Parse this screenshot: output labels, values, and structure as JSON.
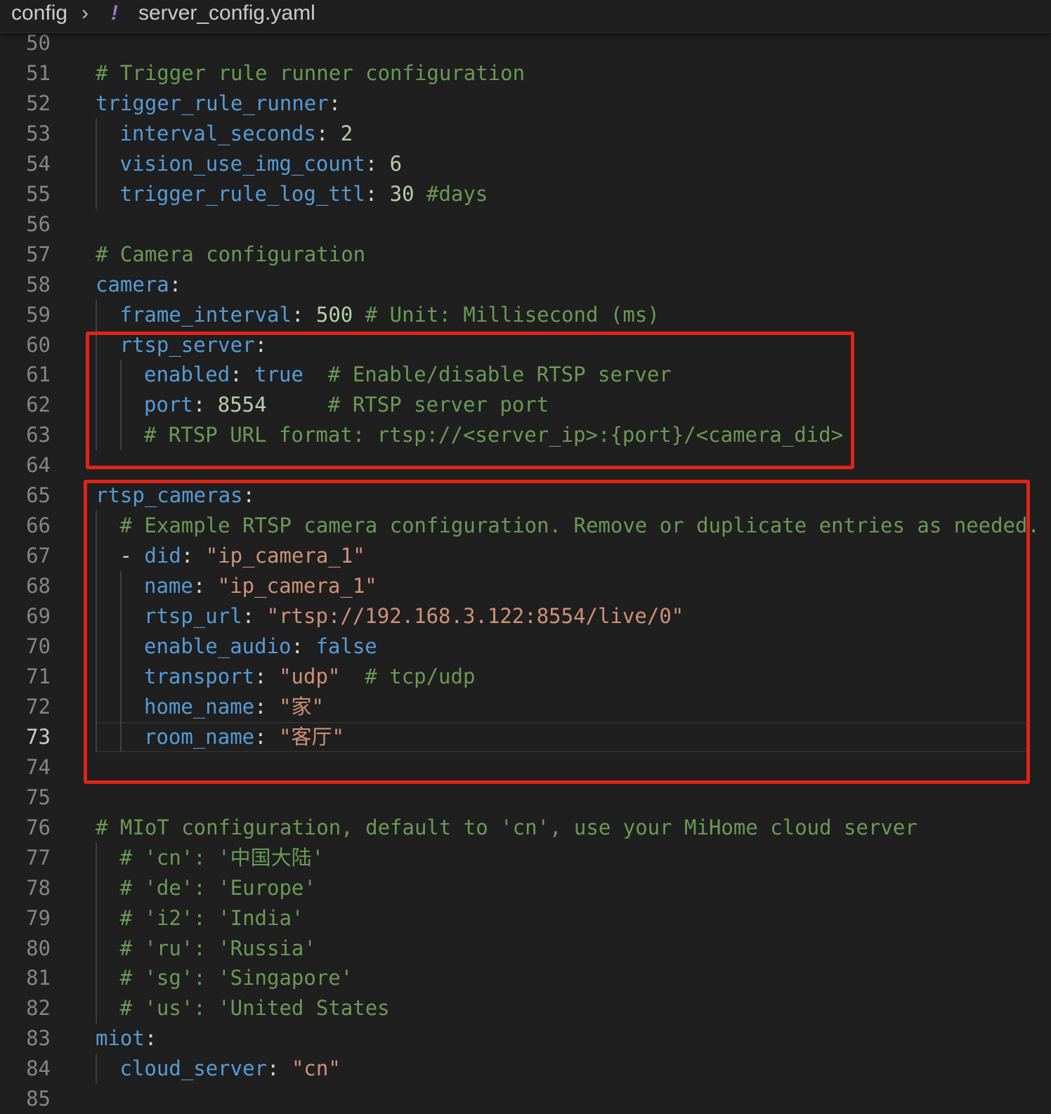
{
  "breadcrumb": {
    "folder": "config",
    "separator": "›",
    "file_icon": "!",
    "file_icon_name": "yaml-file-icon",
    "file": "server_config.yaml"
  },
  "editor": {
    "current_line": 73,
    "colors": {
      "key": "#569cd6",
      "comment": "#6a9955",
      "string": "#ce9178",
      "number": "#b5cea8",
      "highlight_box": "#e02418"
    },
    "lines": [
      {
        "n": "50",
        "indent": 0,
        "tokens": []
      },
      {
        "n": "51",
        "indent": 0,
        "tokens": [
          {
            "t": "c",
            "v": "# Trigger rule runner configuration"
          }
        ]
      },
      {
        "n": "52",
        "indent": 0,
        "tokens": [
          {
            "t": "k",
            "v": "trigger_rule_runner"
          },
          {
            "t": "p",
            "v": ":"
          }
        ]
      },
      {
        "n": "53",
        "indent": 1,
        "tokens": [
          {
            "t": "k",
            "v": "interval_seconds"
          },
          {
            "t": "p",
            "v": ": "
          },
          {
            "t": "n",
            "v": "2"
          }
        ]
      },
      {
        "n": "54",
        "indent": 1,
        "tokens": [
          {
            "t": "k",
            "v": "vision_use_img_count"
          },
          {
            "t": "p",
            "v": ": "
          },
          {
            "t": "n",
            "v": "6"
          }
        ]
      },
      {
        "n": "55",
        "indent": 1,
        "tokens": [
          {
            "t": "k",
            "v": "trigger_rule_log_ttl"
          },
          {
            "t": "p",
            "v": ": "
          },
          {
            "t": "n",
            "v": "30"
          },
          {
            "t": "p",
            "v": " "
          },
          {
            "t": "c",
            "v": "#days"
          }
        ]
      },
      {
        "n": "56",
        "indent": 0,
        "tokens": []
      },
      {
        "n": "57",
        "indent": 0,
        "tokens": [
          {
            "t": "c",
            "v": "# Camera configuration"
          }
        ]
      },
      {
        "n": "58",
        "indent": 0,
        "tokens": [
          {
            "t": "k",
            "v": "camera"
          },
          {
            "t": "p",
            "v": ":"
          }
        ]
      },
      {
        "n": "59",
        "indent": 1,
        "tokens": [
          {
            "t": "k",
            "v": "frame_interval"
          },
          {
            "t": "p",
            "v": ": "
          },
          {
            "t": "n",
            "v": "500"
          },
          {
            "t": "p",
            "v": " "
          },
          {
            "t": "c",
            "v": "# Unit: Millisecond (ms)"
          }
        ]
      },
      {
        "n": "60",
        "indent": 1,
        "tokens": [
          {
            "t": "k",
            "v": "rtsp_server"
          },
          {
            "t": "p",
            "v": ":"
          }
        ]
      },
      {
        "n": "61",
        "indent": 2,
        "tokens": [
          {
            "t": "k",
            "v": "enabled"
          },
          {
            "t": "p",
            "v": ": "
          },
          {
            "t": "b",
            "v": "true"
          },
          {
            "t": "p",
            "v": "  "
          },
          {
            "t": "c",
            "v": "# Enable/disable RTSP server"
          }
        ]
      },
      {
        "n": "62",
        "indent": 2,
        "tokens": [
          {
            "t": "k",
            "v": "port"
          },
          {
            "t": "p",
            "v": ": "
          },
          {
            "t": "n",
            "v": "8554"
          },
          {
            "t": "p",
            "v": "     "
          },
          {
            "t": "c",
            "v": "# RTSP server port"
          }
        ]
      },
      {
        "n": "63",
        "indent": 2,
        "tokens": [
          {
            "t": "c",
            "v": "# RTSP URL format: rtsp://<server_ip>:{port}/<camera_did>"
          }
        ]
      },
      {
        "n": "64",
        "indent": 0,
        "tokens": []
      },
      {
        "n": "65",
        "indent": 0,
        "tokens": [
          {
            "t": "k",
            "v": "rtsp_cameras"
          },
          {
            "t": "p",
            "v": ":"
          }
        ]
      },
      {
        "n": "66",
        "indent": 1,
        "tokens": [
          {
            "t": "c",
            "v": "# Example RTSP camera configuration. Remove or duplicate entries as needed."
          }
        ]
      },
      {
        "n": "67",
        "indent": 1,
        "tokens": [
          {
            "t": "p",
            "v": "- "
          },
          {
            "t": "k",
            "v": "did"
          },
          {
            "t": "p",
            "v": ": "
          },
          {
            "t": "s",
            "v": "\"ip_camera_1\""
          }
        ]
      },
      {
        "n": "68",
        "indent": 2,
        "tokens": [
          {
            "t": "k",
            "v": "name"
          },
          {
            "t": "p",
            "v": ": "
          },
          {
            "t": "s",
            "v": "\"ip_camera_1\""
          }
        ]
      },
      {
        "n": "69",
        "indent": 2,
        "tokens": [
          {
            "t": "k",
            "v": "rtsp_url"
          },
          {
            "t": "p",
            "v": ": "
          },
          {
            "t": "s",
            "v": "\"rtsp://192.168.3.122:8554/live/0\""
          }
        ]
      },
      {
        "n": "70",
        "indent": 2,
        "tokens": [
          {
            "t": "k",
            "v": "enable_audio"
          },
          {
            "t": "p",
            "v": ": "
          },
          {
            "t": "b",
            "v": "false"
          }
        ]
      },
      {
        "n": "71",
        "indent": 2,
        "tokens": [
          {
            "t": "k",
            "v": "transport"
          },
          {
            "t": "p",
            "v": ": "
          },
          {
            "t": "s",
            "v": "\"udp\""
          },
          {
            "t": "p",
            "v": "  "
          },
          {
            "t": "c",
            "v": "# tcp/udp"
          }
        ]
      },
      {
        "n": "72",
        "indent": 2,
        "tokens": [
          {
            "t": "k",
            "v": "home_name"
          },
          {
            "t": "p",
            "v": ": "
          },
          {
            "t": "s",
            "v": "\"家\""
          }
        ]
      },
      {
        "n": "73",
        "indent": 2,
        "tokens": [
          {
            "t": "k",
            "v": "room_name"
          },
          {
            "t": "p",
            "v": ": "
          },
          {
            "t": "s",
            "v": "\"客厅\""
          }
        ]
      },
      {
        "n": "74",
        "indent": 0,
        "tokens": []
      },
      {
        "n": "75",
        "indent": 0,
        "tokens": []
      },
      {
        "n": "76",
        "indent": 0,
        "tokens": [
          {
            "t": "c",
            "v": "# MIoT configuration, default to 'cn', use your MiHome cloud server"
          }
        ]
      },
      {
        "n": "77",
        "indent": 1,
        "tokens": [
          {
            "t": "c",
            "v": "# 'cn': '中国大陆'"
          }
        ]
      },
      {
        "n": "78",
        "indent": 1,
        "tokens": [
          {
            "t": "c",
            "v": "# 'de': 'Europe'"
          }
        ]
      },
      {
        "n": "79",
        "indent": 1,
        "tokens": [
          {
            "t": "c",
            "v": "# 'i2': 'India'"
          }
        ]
      },
      {
        "n": "80",
        "indent": 1,
        "tokens": [
          {
            "t": "c",
            "v": "# 'ru': 'Russia'"
          }
        ]
      },
      {
        "n": "81",
        "indent": 1,
        "tokens": [
          {
            "t": "c",
            "v": "# 'sg': 'Singapore'"
          }
        ]
      },
      {
        "n": "82",
        "indent": 1,
        "tokens": [
          {
            "t": "c",
            "v": "# 'us': 'United States"
          }
        ]
      },
      {
        "n": "83",
        "indent": 0,
        "tokens": [
          {
            "t": "k",
            "v": "miot"
          },
          {
            "t": "p",
            "v": ":"
          }
        ]
      },
      {
        "n": "84",
        "indent": 1,
        "tokens": [
          {
            "t": "k",
            "v": "cloud_server"
          },
          {
            "t": "p",
            "v": ": "
          },
          {
            "t": "s",
            "v": "\"cn\""
          }
        ]
      },
      {
        "n": "85",
        "indent": 0,
        "tokens": []
      }
    ]
  }
}
